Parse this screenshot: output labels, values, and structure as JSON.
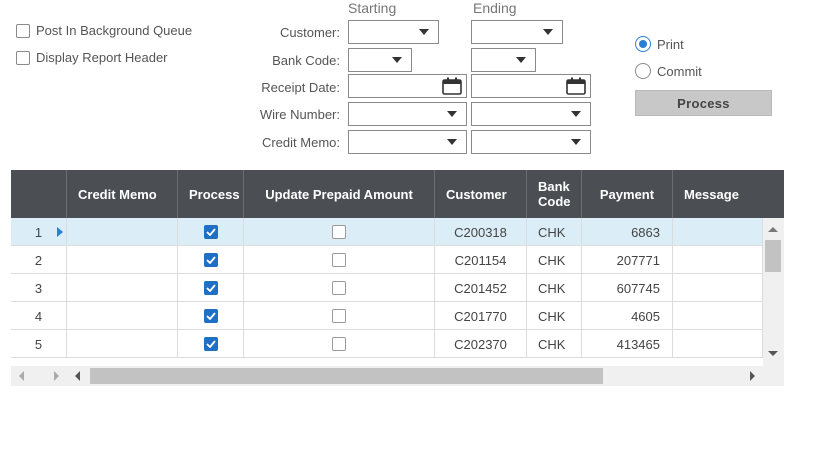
{
  "options": {
    "post_in_background_queue": "Post In Background Queue",
    "display_report_header": "Display Report Header"
  },
  "columns": {
    "starting": "Starting",
    "ending": "Ending"
  },
  "labels": {
    "customer": "Customer:",
    "bank_code": "Bank Code:",
    "receipt_date": "Receipt Date:",
    "wire_number": "Wire Number:",
    "credit_memo": "Credit Memo:"
  },
  "mode": {
    "print": "Print",
    "commit": "Commit",
    "selected": "print"
  },
  "process_label": "Process",
  "grid": {
    "headers": {
      "credit_memo": "Credit Memo",
      "process": "Process",
      "update_prepaid": "Update Prepaid Amount",
      "customer": "Customer",
      "bank_code": "Bank Code",
      "payment": "Payment",
      "message": "Message"
    },
    "rows": [
      {
        "num": "1",
        "credit_memo": "",
        "process": true,
        "update_prepaid": false,
        "customer": "C200318",
        "bank_code": "CHK",
        "payment": "6863",
        "message": ""
      },
      {
        "num": "2",
        "credit_memo": "",
        "process": true,
        "update_prepaid": false,
        "customer": "C201154",
        "bank_code": "CHK",
        "payment": "207771",
        "message": ""
      },
      {
        "num": "3",
        "credit_memo": "",
        "process": true,
        "update_prepaid": false,
        "customer": "C201452",
        "bank_code": "CHK",
        "payment": "607745",
        "message": ""
      },
      {
        "num": "4",
        "credit_memo": "",
        "process": true,
        "update_prepaid": false,
        "customer": "C201770",
        "bank_code": "CHK",
        "payment": "4605",
        "message": ""
      },
      {
        "num": "5",
        "credit_memo": "",
        "process": true,
        "update_prepaid": false,
        "customer": "C202370",
        "bank_code": "CHK",
        "payment": "413465",
        "message": ""
      }
    ],
    "selected_row": 0
  },
  "colors": {
    "header_bg": "#4b4f54",
    "selected_row": "#dbeef7",
    "accent": "#1f6fc5",
    "button_bg": "#c8c8c8"
  },
  "icons": {
    "calendar": "calendar-icon",
    "dropdown": "chevron-down-icon",
    "row_indicator": "row-indicator-icon"
  }
}
